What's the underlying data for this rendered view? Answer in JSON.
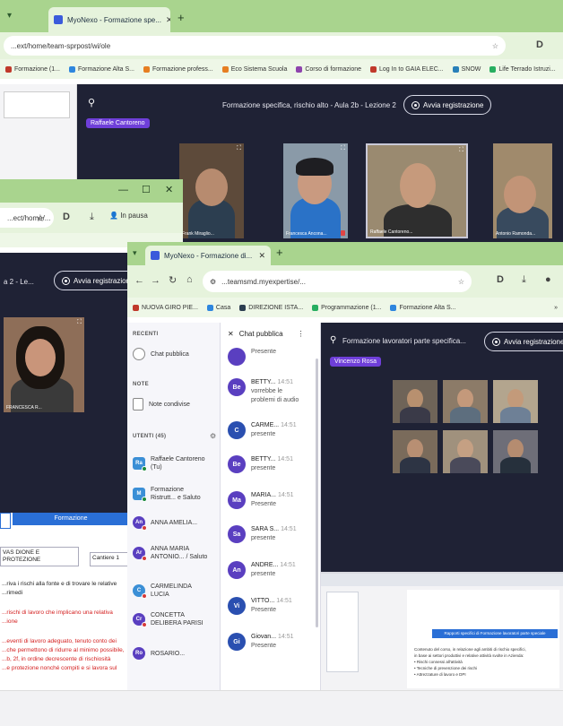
{
  "back_window": {
    "tab_title": "MyoNexo - Formazione spe...",
    "url": "...ext/home/team-sprpost/wi/ole",
    "bookmarks": [
      {
        "label": "Formazione (1...",
        "color": "#c0392b"
      },
      {
        "label": "Formazione Alta S...",
        "color": "#2e86de"
      },
      {
        "label": "Formazione profess...",
        "color": "#e67e22"
      },
      {
        "label": "Eco Sistema Scuola",
        "color": "#e67e22"
      },
      {
        "label": "Corso di formazione",
        "color": "#8e44ad"
      },
      {
        "label": "Log In to GAIA ELEC...",
        "color": "#c0392b"
      },
      {
        "label": "SNOW",
        "color": "#2980b9"
      },
      {
        "label": "Life Terrado Istruzi...",
        "color": "#27ae60"
      }
    ],
    "meeting_title": "Formazione specifica, rischio alto - Aula 2b - Lezione 2",
    "host_chip": "Raffaele Cantoreno",
    "record_button": "Avvia registrazione",
    "participants": [
      {
        "name": "Frank Miraglio...",
        "bg": "#5d4a3a",
        "face": "#b78b6f",
        "shirt": "#2c3e50"
      },
      {
        "name": "Francesca Ancona...",
        "bg": "#8a9aa8",
        "face": "#c99a80",
        "shirt": "#2a72c7"
      },
      {
        "name": "Raffaele Cantoreno...",
        "bg": "#9a8a70",
        "face": "#c69a7c",
        "shirt": "#2e2e2e"
      },
      {
        "name": "Antonio Ramonda...",
        "bg": "#a08a6c",
        "face": "#c29477",
        "shirt": "#384a5e"
      }
    ]
  },
  "middle_window": {
    "url": "...ect/home/...",
    "profile_label": "In pausa",
    "title_fragment": "a 2 - Le...",
    "record_button": "Avvia registrazione",
    "participant_name": "FRANCESCA R...",
    "doc": {
      "blue_bar": "Formazione",
      "field_a": "VAS DIONE E PROTEZIONE",
      "field_b": "Cantiere 1",
      "line1": "...riva i rischi alla fonte e di trovare le relative",
      "line2": "...rimedi",
      "red_lines": [
        "...rischi di lavoro che implicano una relativa",
        "...ione",
        "...eventi di lavoro adeguato, tenuto conto dei",
        "...che permettono di ridurre al minimo possibile,",
        "...b, 2f, in ordine decrescente di rischiosità",
        "...e protezione nonché compiti e si lavora sul"
      ]
    }
  },
  "front_window": {
    "tab_title": "MyoNexo - Formazione di...",
    "url": "...teamsmd.myexpertise/...",
    "bookmarks": [
      {
        "label": "NUOVA GIRO PIE...",
        "color": "#c0392b"
      },
      {
        "label": "Casa",
        "color": "#2e86de"
      },
      {
        "label": "DIREZIONE ISTA...",
        "color": "#2c3e50"
      },
      {
        "label": "Programmazione (1...",
        "color": "#27ae60"
      },
      {
        "label": "Formazione Alta S...",
        "color": "#2e86de"
      }
    ],
    "rail": {
      "section_recent": "RECENTI",
      "recent_item": "Chat pubblica",
      "section_notes": "NOTE",
      "notes_item": "Note condivise",
      "section_users": "UTENTI (45)",
      "contacts": [
        {
          "initials": "Ra",
          "label": "Raffaele Cantoreno (Tu)",
          "color": "#3b8fd6"
        },
        {
          "initials": "M",
          "label": "Formazione Ristrutt... e Saluto",
          "color": "#3b8fd6"
        },
        {
          "initials": "An",
          "label": "ANNA AMELIA...",
          "color": "#5a3fc0"
        },
        {
          "initials": "Ar",
          "label": "ANNA MARIA ANTONIO... / Saluto",
          "color": "#5a3fc0"
        },
        {
          "initials": "C",
          "label": "CARMELINDA LUCIA",
          "color": "#3b8fd6"
        },
        {
          "initials": "Cr",
          "label": "CONCETTA DELIBERA PARISI",
          "color": "#5a3fc0"
        },
        {
          "initials": "Ro",
          "label": "ROSARIO...",
          "color": "#5a3fc0"
        }
      ]
    },
    "chat": {
      "title": "Chat pubblica",
      "messages": [
        {
          "initials": "",
          "name": "",
          "time": "",
          "body": "Presente"
        },
        {
          "initials": "Be",
          "name": "BETTY...",
          "time": "14:51",
          "body": "vorrebbe le problemi di audio"
        },
        {
          "initials": "C",
          "name": "CARME...",
          "time": "14:51",
          "body": "presente"
        },
        {
          "initials": "Be",
          "name": "BETTY...",
          "time": "14:51",
          "body": "presente"
        },
        {
          "initials": "Ma",
          "name": "MARIA...",
          "time": "14:51",
          "body": "Presente"
        },
        {
          "initials": "Sa",
          "name": "SARA S...",
          "time": "14:51",
          "body": "presente"
        },
        {
          "initials": "An",
          "name": "ANDRE...",
          "time": "14:51",
          "body": "presente"
        },
        {
          "initials": "Vi",
          "name": "VITTO...",
          "time": "14:51",
          "body": "Presente"
        },
        {
          "initials": "Gi",
          "name": "Giovan...",
          "time": "14:51",
          "body": "Presente"
        }
      ]
    },
    "meeting_title": "Formazione lavoratori parte specifica...",
    "host_chip": "Vincenzo Rosa",
    "record_button": "Avvia registrazione",
    "grid": [
      {
        "bg": "#6f6458",
        "face": "#b8906f",
        "shirt": "#3a3a48"
      },
      {
        "bg": "#8c7b68",
        "face": "#c4997b",
        "shirt": "#5d6e7e"
      },
      {
        "bg": "#b3a58e",
        "face": "#c39a7a",
        "shirt": "#6e8096"
      },
      {
        "bg": "#7a6b5b",
        "face": "#b88f73",
        "shirt": "#2d3444"
      },
      {
        "bg": "#a0917d",
        "face": "#c5a083",
        "shirt": "#4a4a5a"
      },
      {
        "bg": "#6e6e78",
        "face": "#b58c70",
        "shirt": "#26303c"
      }
    ],
    "shared_doc_header": "Rapporti specifici di Formazione lavoratori parte speciale",
    "shared_doc_lines": [
      "Contenuto del corso, in relazione agli ambiti di rischio specifici,",
      "in base ai settori produttivi e relative attività svolte in Azienda:",
      "• Rischi connessi all'attività",
      "• Tecniche di prevenzione dei rischi",
      "• Attrezzature di lavoro e DPI"
    ]
  }
}
